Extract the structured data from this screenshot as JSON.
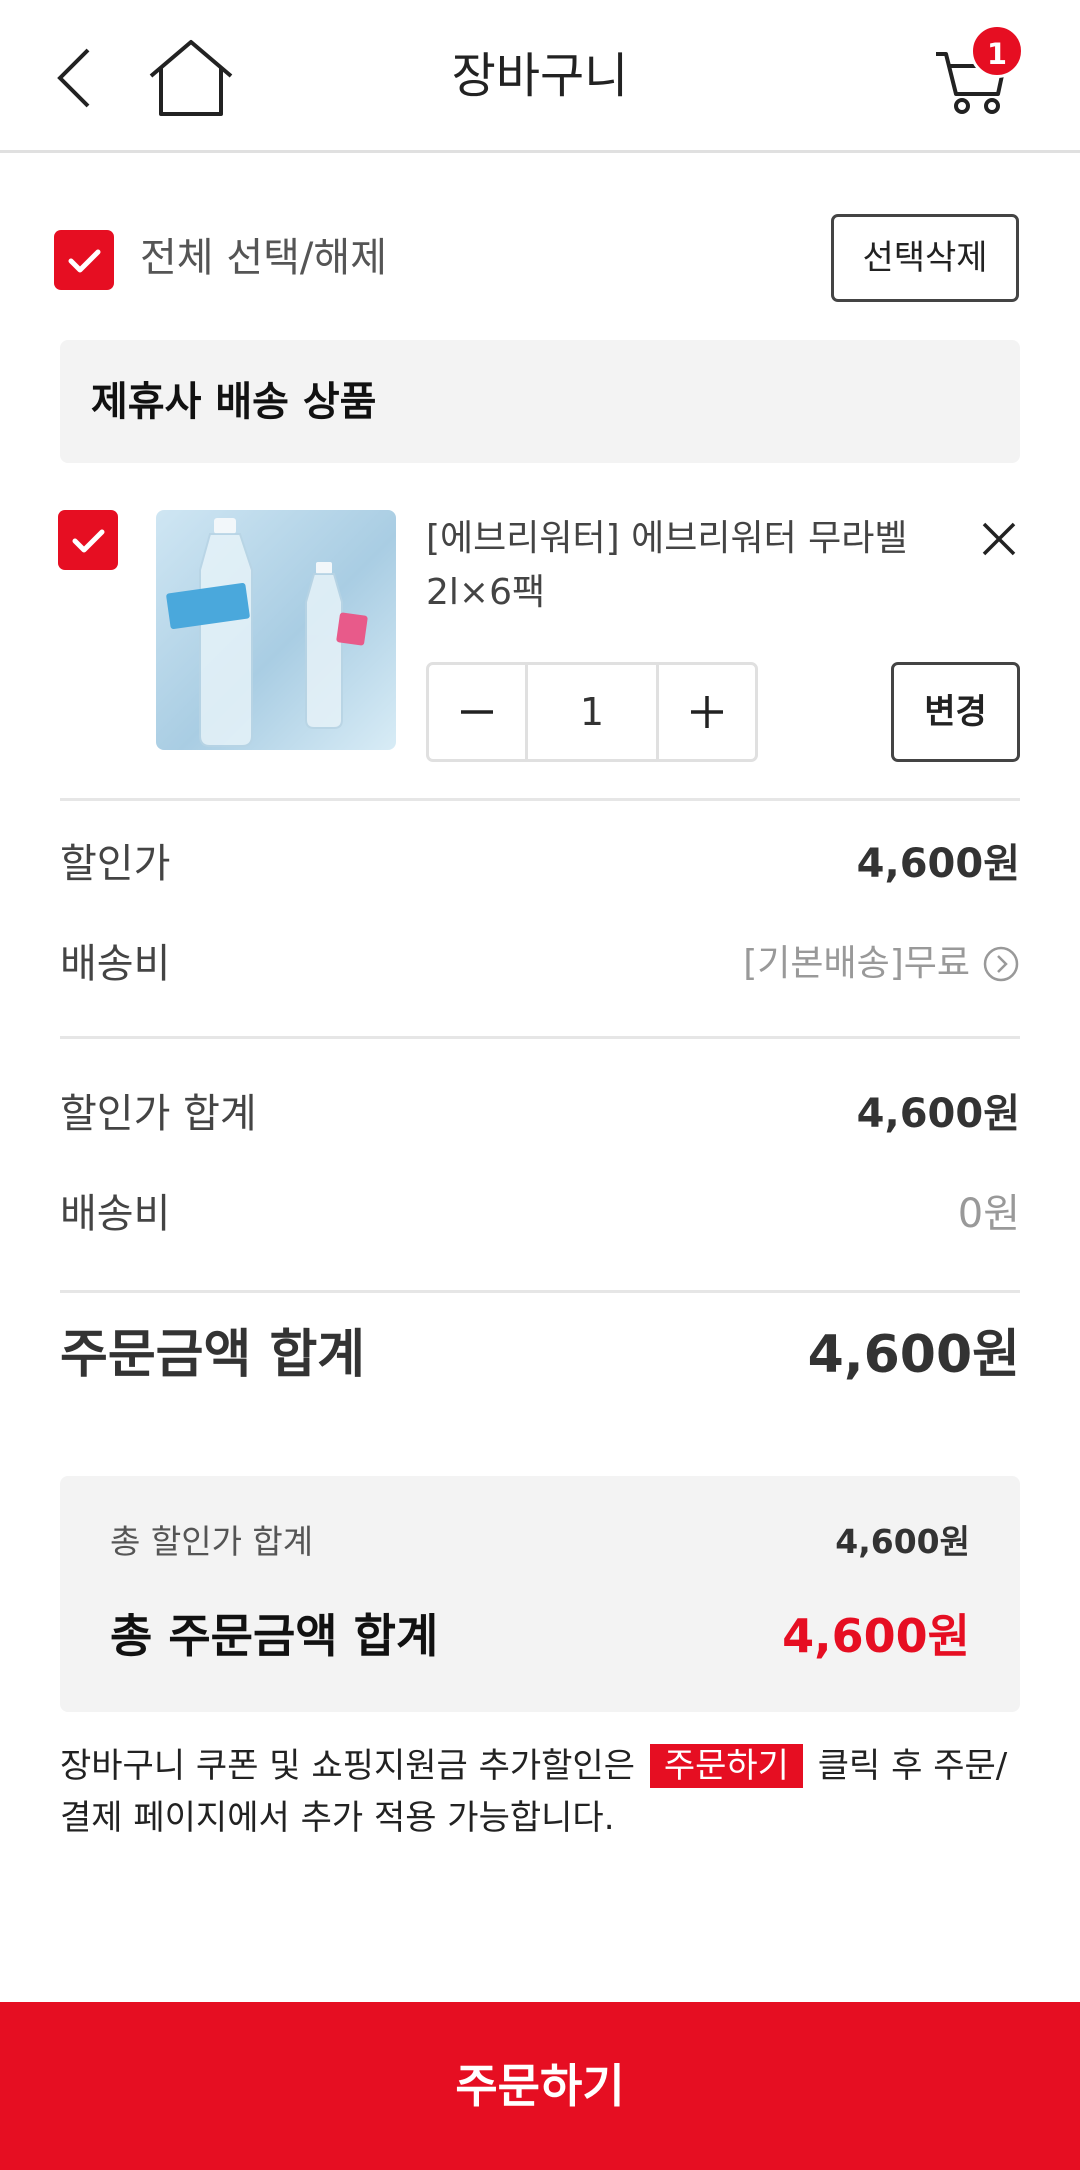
{
  "header": {
    "title": "장바구니",
    "cart_count": "1",
    "back_icon": "chevron-left-icon",
    "home_icon": "home-icon",
    "cart_icon": "cart-icon"
  },
  "select_all": {
    "label": "전체 선택/해제",
    "checked": true,
    "delete_label": "선택삭제"
  },
  "section": {
    "title": "제휴사 배송 상품"
  },
  "product": {
    "name": "[에브리워터] 에브리워터 무라벨 2l×6팩",
    "quantity": "1",
    "change_label": "변경",
    "checked": true
  },
  "item_summary": {
    "discount_price_label": "할인가",
    "discount_price_value": "4,600원",
    "shipping_label": "배송비",
    "shipping_value": "[기본배송]무료"
  },
  "totals": {
    "discount_sum_label": "할인가 합계",
    "discount_sum_value": "4,600원",
    "shipping_label": "배송비",
    "shipping_value": "0원",
    "order_total_label": "주문금액 합계",
    "order_total_value": "4,600원"
  },
  "summary_box": {
    "total_discount_label": "총 할인가 합계",
    "total_discount_value": "4,600원",
    "total_order_label": "총 주문금액 합계",
    "total_order_value": "4,600원"
  },
  "notice": {
    "before": "장바구니 쿠폰 및 쇼핑지원금 추가할인은",
    "tag": "주문하기",
    "after": "클릭 후 주문/결제 페이지에서 추가 적용 가능합니다."
  },
  "order_button": "주문하기",
  "colors": {
    "accent": "#e60e22",
    "panel_bg": "#f3f3f3",
    "divider": "#e6e6e6"
  }
}
